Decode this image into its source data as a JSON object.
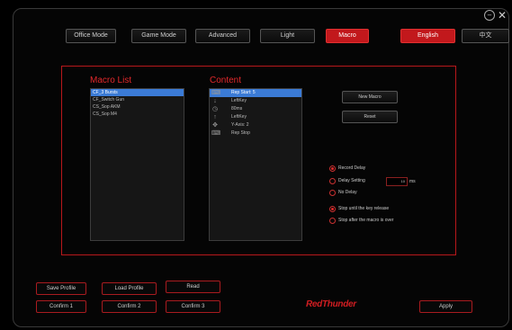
{
  "window_controls": {
    "minimize": "–",
    "close": "✕"
  },
  "mode_tabs": [
    {
      "label": "Office Mode",
      "active": false
    },
    {
      "label": "Game Mode",
      "active": false
    },
    {
      "label": "Advanced",
      "active": false
    },
    {
      "label": "Light",
      "active": false
    },
    {
      "label": "Macro",
      "active": true
    }
  ],
  "language": {
    "english": "English",
    "chinese": "中文"
  },
  "macro_list": {
    "title": "Macro List",
    "items": [
      "CF_3 Bursts",
      "CF_Switch Gun",
      "CS_Sop AKM",
      "CS_Sop M4"
    ],
    "selected_index": 0
  },
  "content": {
    "title": "Content",
    "rows": [
      {
        "icon": "keyboard-icon",
        "glyph": "⌨",
        "text": "Rep Start: 5"
      },
      {
        "icon": "arrow-down-icon",
        "glyph": "↓",
        "text": "LeftKey"
      },
      {
        "icon": "clock-icon",
        "glyph": "◷",
        "text": "80ms"
      },
      {
        "icon": "arrow-up-icon",
        "glyph": "↑",
        "text": "LeftKey"
      },
      {
        "icon": "move-icon",
        "glyph": "✥",
        "text": "Y-Axis: 2"
      },
      {
        "icon": "keyboard-icon",
        "glyph": "⌨",
        "text": "Rep Stop"
      }
    ],
    "selected_index": 0
  },
  "actions": {
    "new_macro": "New Macro",
    "reset": "Reset"
  },
  "delay_options": [
    {
      "label": "Record Delay",
      "checked": true
    },
    {
      "label": "Delay Setting",
      "checked": false
    },
    {
      "label": "No Delay",
      "checked": false
    }
  ],
  "delay_value": "10",
  "delay_unit": "ms",
  "repeat_options": [
    {
      "label": "Stop until the key release",
      "checked": true
    },
    {
      "label": "Stop after the macro is over",
      "checked": false
    }
  ],
  "profile_buttons": {
    "save": "Save Profile",
    "load": "Load Profile",
    "read": "Read"
  },
  "confirm_buttons": [
    "Confirm 1",
    "Confirm 2",
    "Confirm 3"
  ],
  "brand": "RedThunder",
  "apply": "Apply",
  "colors": {
    "accent": "#c2181c",
    "selection": "#3b7bd6",
    "frame": "#b8171b"
  }
}
